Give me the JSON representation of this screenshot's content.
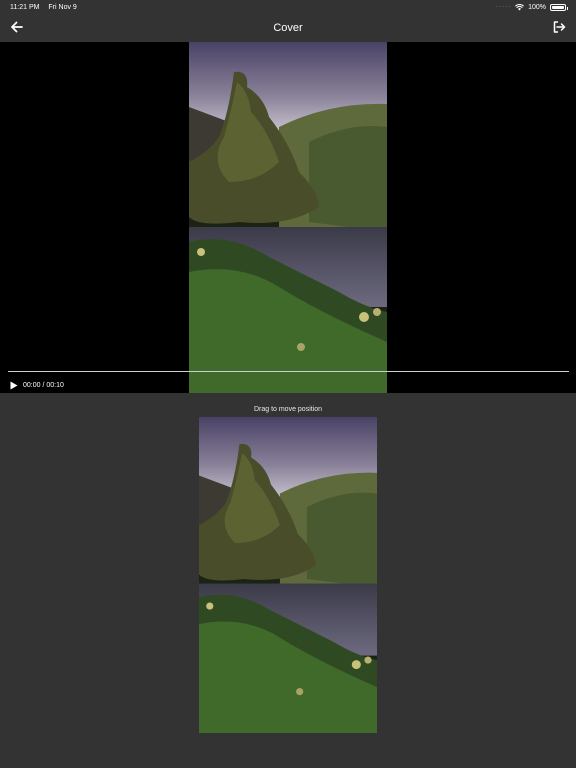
{
  "status_bar": {
    "time": "11:21 PM",
    "date": "Fri Nov 9",
    "signal": "·····",
    "battery_percent": "100%"
  },
  "nav": {
    "title": "Cover",
    "back_icon": "arrow-left-icon",
    "exit_icon": "sign-out-icon"
  },
  "player": {
    "time_display": "00:00 / 00:10",
    "progress": 0,
    "play_icon": "play-icon"
  },
  "cover": {
    "hint": "Drag to move position"
  },
  "colors": {
    "background": "#333333",
    "player_background": "#000000",
    "text": "#ffffff"
  }
}
